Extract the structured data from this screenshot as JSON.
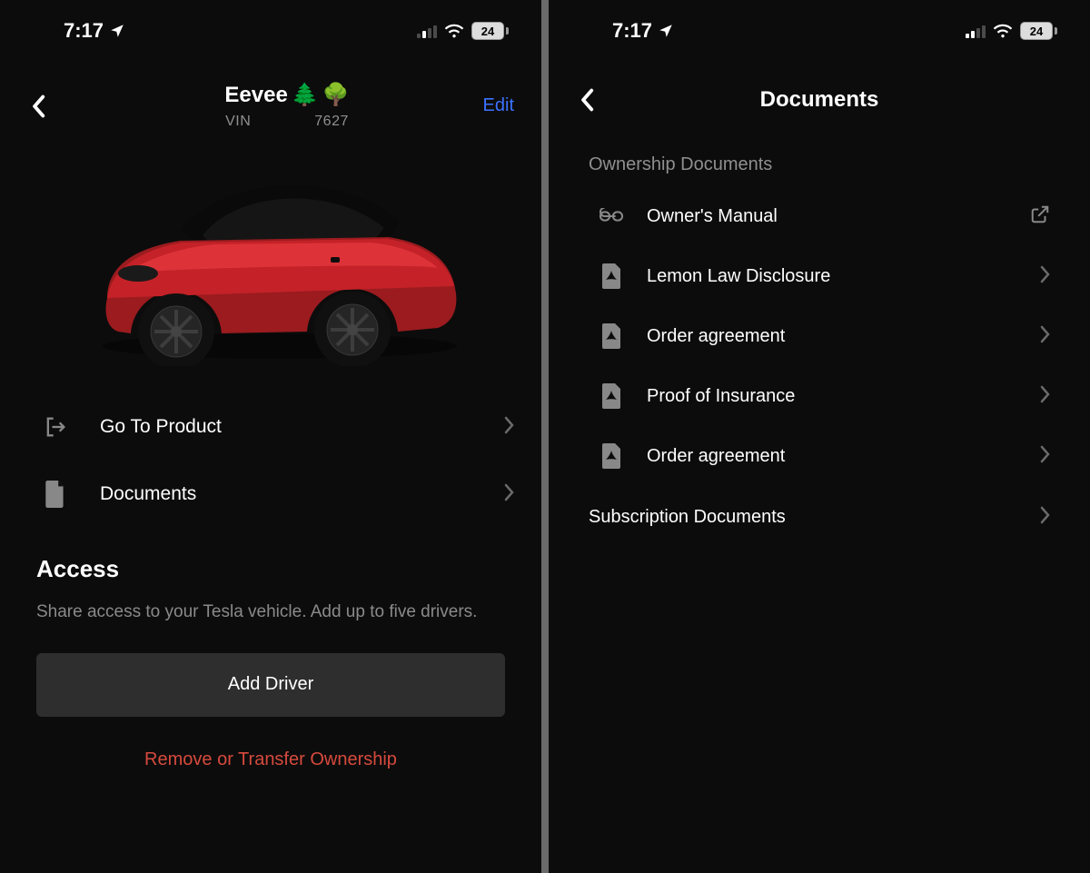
{
  "status": {
    "time": "7:17",
    "battery": "24"
  },
  "left": {
    "vehicle_name": "Eevee",
    "emoji1": "🌲",
    "emoji2": "🌳",
    "vin_label": "VIN",
    "vin_tail": "7627",
    "edit": "Edit",
    "rows": {
      "product": "Go To Product",
      "documents": "Documents"
    },
    "access": {
      "heading": "Access",
      "sub": "Share access to your Tesla vehicle. Add up to five drivers.",
      "add_driver": "Add Driver",
      "remove": "Remove or Transfer Ownership"
    }
  },
  "right": {
    "title": "Documents",
    "section": "Ownership Documents",
    "docs": [
      {
        "label": "Owner's Manual",
        "icon": "link",
        "trailing": "external"
      },
      {
        "label": "Lemon Law Disclosure",
        "icon": "pdf",
        "trailing": "chevron"
      },
      {
        "label": "Order agreement",
        "icon": "pdf",
        "trailing": "chevron"
      },
      {
        "label": "Proof of Insurance",
        "icon": "pdf",
        "trailing": "chevron"
      },
      {
        "label": "Order agreement",
        "icon": "pdf",
        "trailing": "chevron"
      }
    ],
    "subscription": "Subscription Documents"
  }
}
